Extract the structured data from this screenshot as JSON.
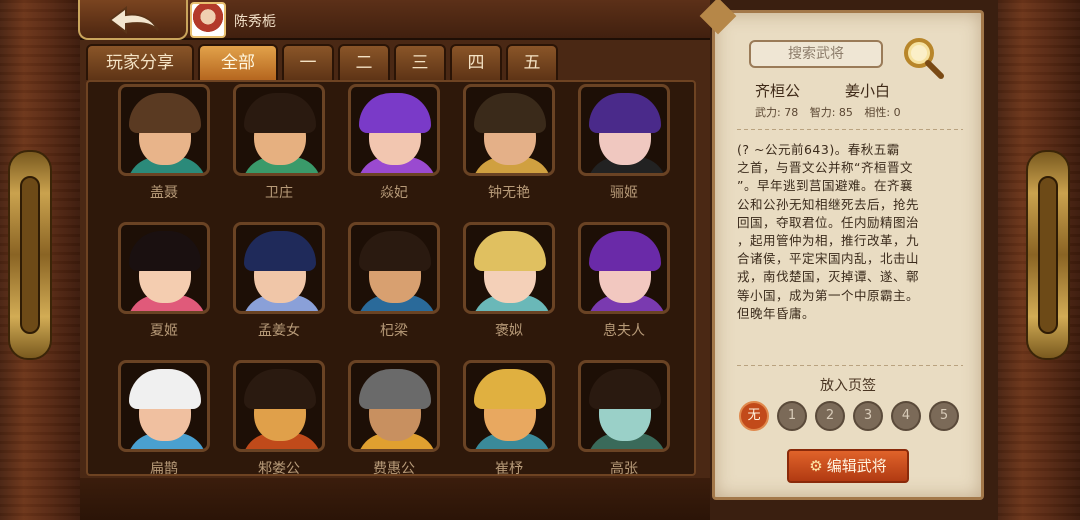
{
  "header": {
    "back_label": "",
    "player_name": "陈秀栀"
  },
  "tabs": [
    {
      "label": "玩家分享",
      "active": false
    },
    {
      "label": "全部",
      "active": true
    },
    {
      "label": "一",
      "active": false
    },
    {
      "label": "二",
      "active": false
    },
    {
      "label": "三",
      "active": false
    },
    {
      "label": "四",
      "active": false
    },
    {
      "label": "五",
      "active": false
    }
  ],
  "heroes": [
    {
      "name": "盖聂",
      "hair": "#5a3a22",
      "skin": "#e8b48a",
      "cloth": "#2b8a7a"
    },
    {
      "name": "卫庄",
      "hair": "#2a1a10",
      "skin": "#e6b080",
      "cloth": "#3a9a6a"
    },
    {
      "name": "焱妃",
      "hair": "#7a3ac8",
      "skin": "#f2c6b0",
      "cloth": "#9a4ad0"
    },
    {
      "name": "钟无艳",
      "hair": "#3a2a1a",
      "skin": "#e4b088",
      "cloth": "#d0a040"
    },
    {
      "name": "骊姬",
      "hair": "#4a2a8a",
      "skin": "#f0c8c0",
      "cloth": "#222222"
    },
    {
      "name": "夏姬",
      "hair": "#1a1010",
      "skin": "#f4cdb0",
      "cloth": "#e05a7a"
    },
    {
      "name": "孟姜女",
      "hair": "#1f2a5a",
      "skin": "#f0c6a8",
      "cloth": "#8aa0d8"
    },
    {
      "name": "杞梁",
      "hair": "#2a1a10",
      "skin": "#d8a070",
      "cloth": "#2a6a9a"
    },
    {
      "name": "褒姒",
      "hair": "#e0c060",
      "skin": "#f4d0b8",
      "cloth": "#6ab8b8"
    },
    {
      "name": "息夫人",
      "hair": "#6a2aa8",
      "skin": "#f2c8c0",
      "cloth": "#7a3ab0"
    },
    {
      "name": "扁鹊",
      "hair": "#f0f0f0",
      "skin": "#f0c0a0",
      "cloth": "#4aa0d0"
    },
    {
      "name": "邾娄公",
      "hair": "#2a1a10",
      "skin": "#e0a04a",
      "cloth": "#c04a1a"
    },
    {
      "name": "费惠公",
      "hair": "#6a6a6a",
      "skin": "#c89060",
      "cloth": "#e0a030"
    },
    {
      "name": "崔杼",
      "hair": "#e0b040",
      "skin": "#e8a860",
      "cloth": "#3a8a9a"
    },
    {
      "name": "高张",
      "hair": "#2a1a10",
      "skin": "#9ad0c8",
      "cloth": "#3a6a5a"
    }
  ],
  "detail": {
    "search_placeholder": "搜索武将",
    "hero_title": "齐桓公",
    "hero_alias": "姜小白",
    "stats": {
      "force": "武力: 78",
      "intellect": "智力: 85",
      "affinity": "相性: 0"
    },
    "bio_lines": [
      "(? ~公元前643)。春秋五霸",
      "之首，与晋文公并称“齐桓晋文",
      "”。早年逃到莒国避难。在齐襄",
      "公和公孙无知相继死去后，抢先",
      "回国，夺取君位。任内励精图治",
      "，起用管仲为相，推行改革，九",
      "合诸侯，平定宋国内乱，北击山",
      "戎，南伐楚国，灭掉谭、遂、鄣",
      "等小国，成为第一个中原霸主。",
      "但晚年昏庸。"
    ],
    "bookmark_label": "放入页签",
    "bookmarks": [
      "无",
      "1",
      "2",
      "3",
      "4",
      "5"
    ],
    "edit_label": "编辑武将"
  },
  "colors": {
    "accent_orange": "#e0632a",
    "tab_active": "#e2a24a",
    "parchment": "#e9dcc2"
  }
}
